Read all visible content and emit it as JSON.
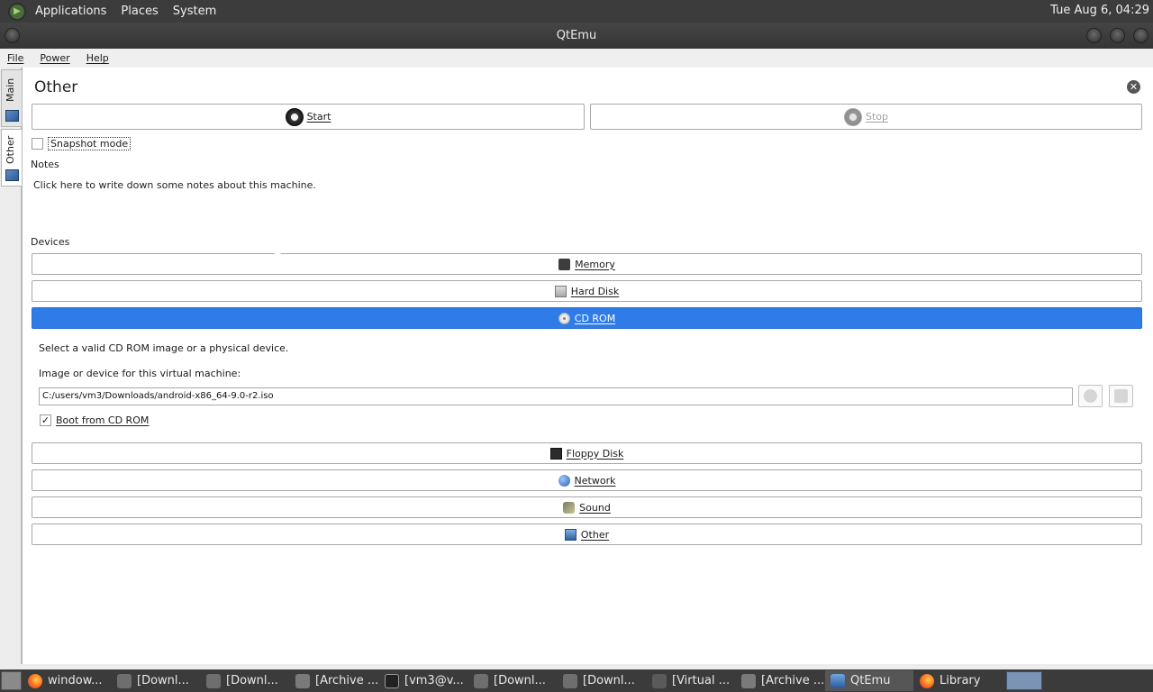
{
  "top_panel": {
    "menus": [
      "Applications",
      "Places",
      "System"
    ],
    "clock": "Tue Aug  6, 04:29"
  },
  "window": {
    "title": "QtEmu"
  },
  "menubar": {
    "items": [
      "File",
      "Power",
      "Help"
    ]
  },
  "side_tabs": [
    {
      "label": "Main"
    },
    {
      "label": "Other"
    }
  ],
  "page": {
    "title": "Other",
    "start_label": "Start",
    "stop_label": "Stop",
    "snapshot_label": "Snapshot mode",
    "notes_label": "Notes",
    "notes_text": "Click here to write down some notes about this machine.",
    "devices_label": "Devices"
  },
  "devices": {
    "memory": "Memory",
    "hard_disk": "Hard Disk",
    "cd_rom": "CD ROM",
    "floppy": "Floppy Disk",
    "network": "Network",
    "sound": "Sound",
    "other": "Other"
  },
  "cd_rom_panel": {
    "info": "Select a valid CD ROM image or a physical device.",
    "image_label": "Image or device for this virtual machine:",
    "path": "C:/users/vm3/Downloads/android-x86_64-9.0-r2.iso",
    "boot_label": "Boot from CD ROM",
    "boot_checked": true
  },
  "taskbar": {
    "tasks": [
      {
        "label": "window...",
        "icon": "firefox"
      },
      {
        "label": "[Downl...",
        "icon": "folder"
      },
      {
        "label": "[Downl...",
        "icon": "folder"
      },
      {
        "label": "[Archive ...",
        "icon": "archive"
      },
      {
        "label": "[vm3@v...",
        "icon": "terminal"
      },
      {
        "label": "[Downl...",
        "icon": "folder"
      },
      {
        "label": "[Downl...",
        "icon": "folder"
      },
      {
        "label": "[Virtual ...",
        "icon": "virtualbox"
      },
      {
        "label": "[Archive ...",
        "icon": "archive"
      },
      {
        "label": "QtEmu",
        "icon": "qtemu"
      },
      {
        "label": "Library",
        "icon": "firefox"
      }
    ]
  }
}
